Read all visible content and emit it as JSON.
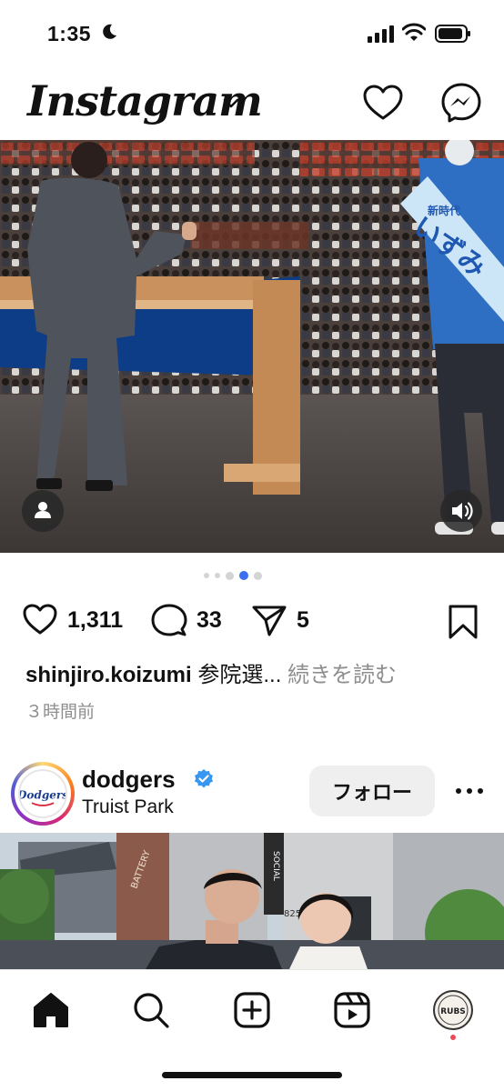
{
  "status_bar": {
    "time": "1:35"
  },
  "header": {
    "logo": "Instagram"
  },
  "post1": {
    "image_count": 5,
    "active_image_index": 3,
    "sash_text": "いずみ",
    "sash_small_text": "新時代",
    "likes": "1,311",
    "comments": "33",
    "shares": "5",
    "username": "shinjiro.koizumi",
    "caption_preview": "参院選...",
    "more_link": "続きを読む",
    "posted_time": "３時間前"
  },
  "post2": {
    "username": "dodgers",
    "verified": true,
    "location": "Truist Park",
    "follow_label": "フォロー",
    "avatar_text": "Dodgers",
    "sign_text": "SOCIAL",
    "building_number": "825",
    "sign2": "BATTERY"
  },
  "bottom_nav": {
    "items": [
      "home-icon",
      "search-icon",
      "create-icon",
      "reels-icon",
      "profile"
    ],
    "profile_avatar_text": "RUBS"
  },
  "colors": {
    "accent": "#3b6ef0",
    "notification": "#ed4956",
    "verified": "#3897f0"
  }
}
